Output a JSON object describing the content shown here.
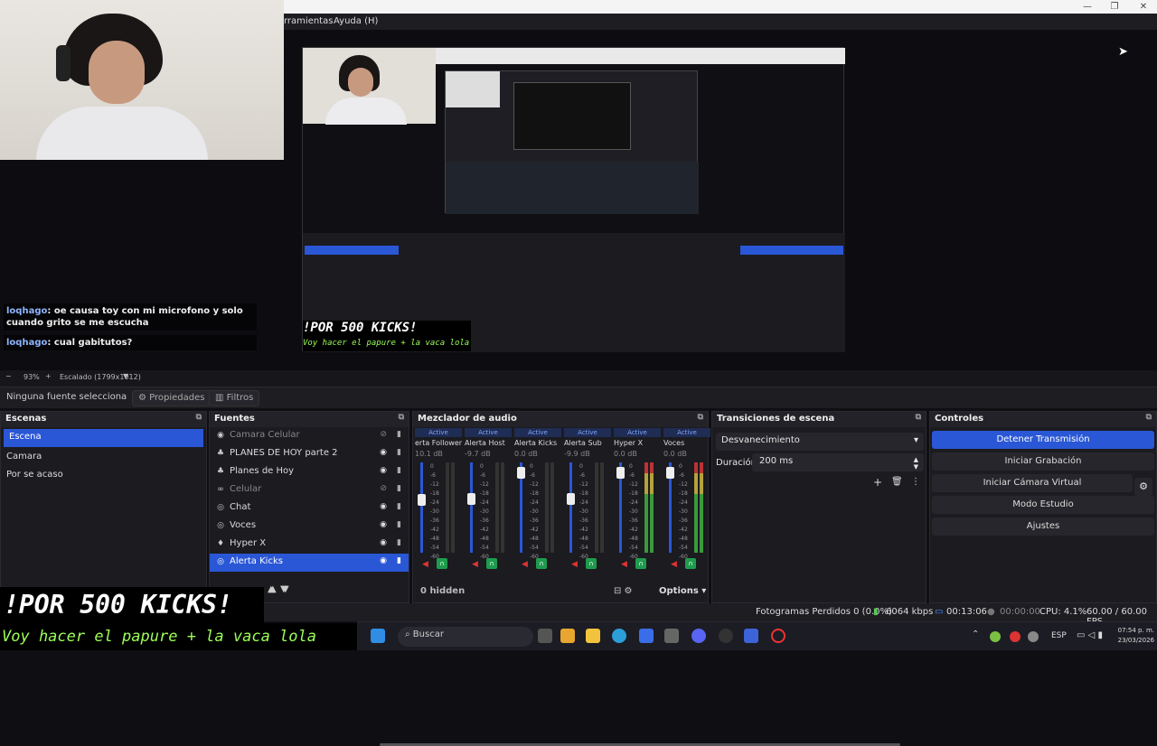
{
  "menubar": {
    "herramientas": "rramientas",
    "ayuda": "Ayuda (H)"
  },
  "window_buttons": [
    "—",
    "❐",
    "✕"
  ],
  "chat": [
    {
      "user": "loqhago",
      "text": ": oe causa toy con mi microfono y solo cuando grito se me escucha"
    },
    {
      "user": "loqhago",
      "text": ": cual gabitutos?"
    }
  ],
  "preview_overlay": {
    "title": "!POR 500 KICKS!",
    "subtitle": "Voy hacer el papure + la vaca lola"
  },
  "zoombar": {
    "zoom": "93%",
    "scale": "Escalado (1799x1012)"
  },
  "toolbar": {
    "source_status": "Ninguna fuente selecciona",
    "properties": "Propiedades",
    "filters": "Filtros"
  },
  "scenes": {
    "title": "Escenas",
    "items": [
      "Escena",
      "Camara",
      "Por se acaso"
    ],
    "selected": 0
  },
  "sources": {
    "title": "Fuentes",
    "items": [
      {
        "label": "Camara Celular",
        "visible": false,
        "icon": "camera-icon"
      },
      {
        "label": "PLANES DE HOY parte 2",
        "visible": true,
        "icon": "text-icon"
      },
      {
        "label": "Planes de Hoy",
        "visible": true,
        "icon": "text-icon"
      },
      {
        "label": "Celular",
        "visible": false,
        "icon": "link-icon"
      },
      {
        "label": "Chat",
        "visible": true,
        "icon": "browser-icon"
      },
      {
        "label": "Voces",
        "visible": true,
        "icon": "browser-icon"
      },
      {
        "label": "Hyper X",
        "visible": true,
        "icon": "microphone-icon"
      },
      {
        "label": "Alerta Kicks",
        "visible": true,
        "icon": "browser-icon"
      }
    ]
  },
  "mixer": {
    "title": "Mezclador de audio",
    "status_label": "Active",
    "channels": [
      {
        "name": "erta Follower",
        "db": "10.1 dB",
        "level": 0.65
      },
      {
        "name": "Alerta Host",
        "db": "-9.7 dB",
        "level": 0.66
      },
      {
        "name": "Alerta Kicks",
        "db": "0.0 dB",
        "level": 0.95
      },
      {
        "name": "Alerta Sub",
        "db": "-9.9 dB",
        "level": 0.66
      },
      {
        "name": "Hyper X",
        "db": "0.0 dB",
        "level": 0.95
      },
      {
        "name": "Voces",
        "db": "0.0 dB",
        "level": 0.95
      }
    ],
    "scale": [
      "0",
      "-6",
      "-12",
      "-18",
      "-24",
      "-30",
      "-36",
      "-42",
      "-48",
      "-54",
      "-60"
    ],
    "hidden": "0 hidden",
    "options": "Options"
  },
  "transitions": {
    "title": "Transiciones de escena",
    "selected": "Desvanecimiento",
    "duration_label": "Duración",
    "duration_value": "200 ms"
  },
  "controls": {
    "title": "Controles",
    "buttons": [
      "Detener Transmisión",
      "Iniciar Grabación",
      "Iniciar Cámara Virtual",
      "Modo Estudio",
      "Ajustes"
    ]
  },
  "status": {
    "dropped": "Fotogramas Perdidos 0 (0.0%)",
    "bitrate": "6064 kbps",
    "stream_time": "00:13:06",
    "rec_time": "00:00:00",
    "cpu": "CPU: 4.1%",
    "fps": "60.00 / 60.00 FPS"
  },
  "taskbar": {
    "search_placeholder": "Buscar",
    "lang": "ESP",
    "time": "07:54 p. m.",
    "date": "23/03/2026"
  },
  "colors": {
    "accent": "#2a57d6",
    "active_green": "#1e9c4d",
    "overlay_green": "#9cff57"
  }
}
